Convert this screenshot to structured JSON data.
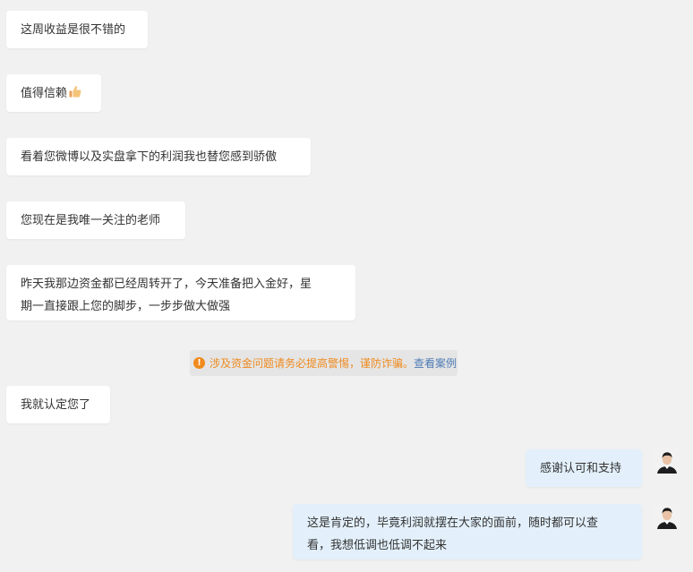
{
  "messages_incoming": [
    {
      "text": "这周收益是很不错的"
    },
    {
      "text": "值得信赖",
      "emoji": "thumbs-up-icon"
    },
    {
      "text": "看着您微博以及实盘拿下的利润我也替您感到骄傲"
    },
    {
      "text": "您现在是我唯一关注的老师"
    },
    {
      "line1": "昨天我那边资金都已经周转开了，今天准备把入金好，星",
      "line2": "期一直接跟上您的脚步，一步步做大做强"
    },
    {
      "text": "我就认定您了"
    }
  ],
  "notice": {
    "icon": "warning-icon",
    "text": "涉及资金问题请务必提高警惕，谨防诈骗。",
    "link": "查看案例",
    "text_color": "#ee8a1e",
    "link_color": "#4d7bb5"
  },
  "messages_outgoing": [
    {
      "text": "感谢认可和支持",
      "avatar": "avatar-icon"
    },
    {
      "line1": "这是肯定的，毕竟利润就摆在大家的面前，随时都可以查",
      "line2": "看，我想低调也低调不起来",
      "avatar": "avatar-icon"
    }
  ],
  "colors": {
    "background": "#f1f1f1",
    "incoming_bubble": "#ffffff",
    "outgoing_bubble": "#e3f0fb"
  }
}
